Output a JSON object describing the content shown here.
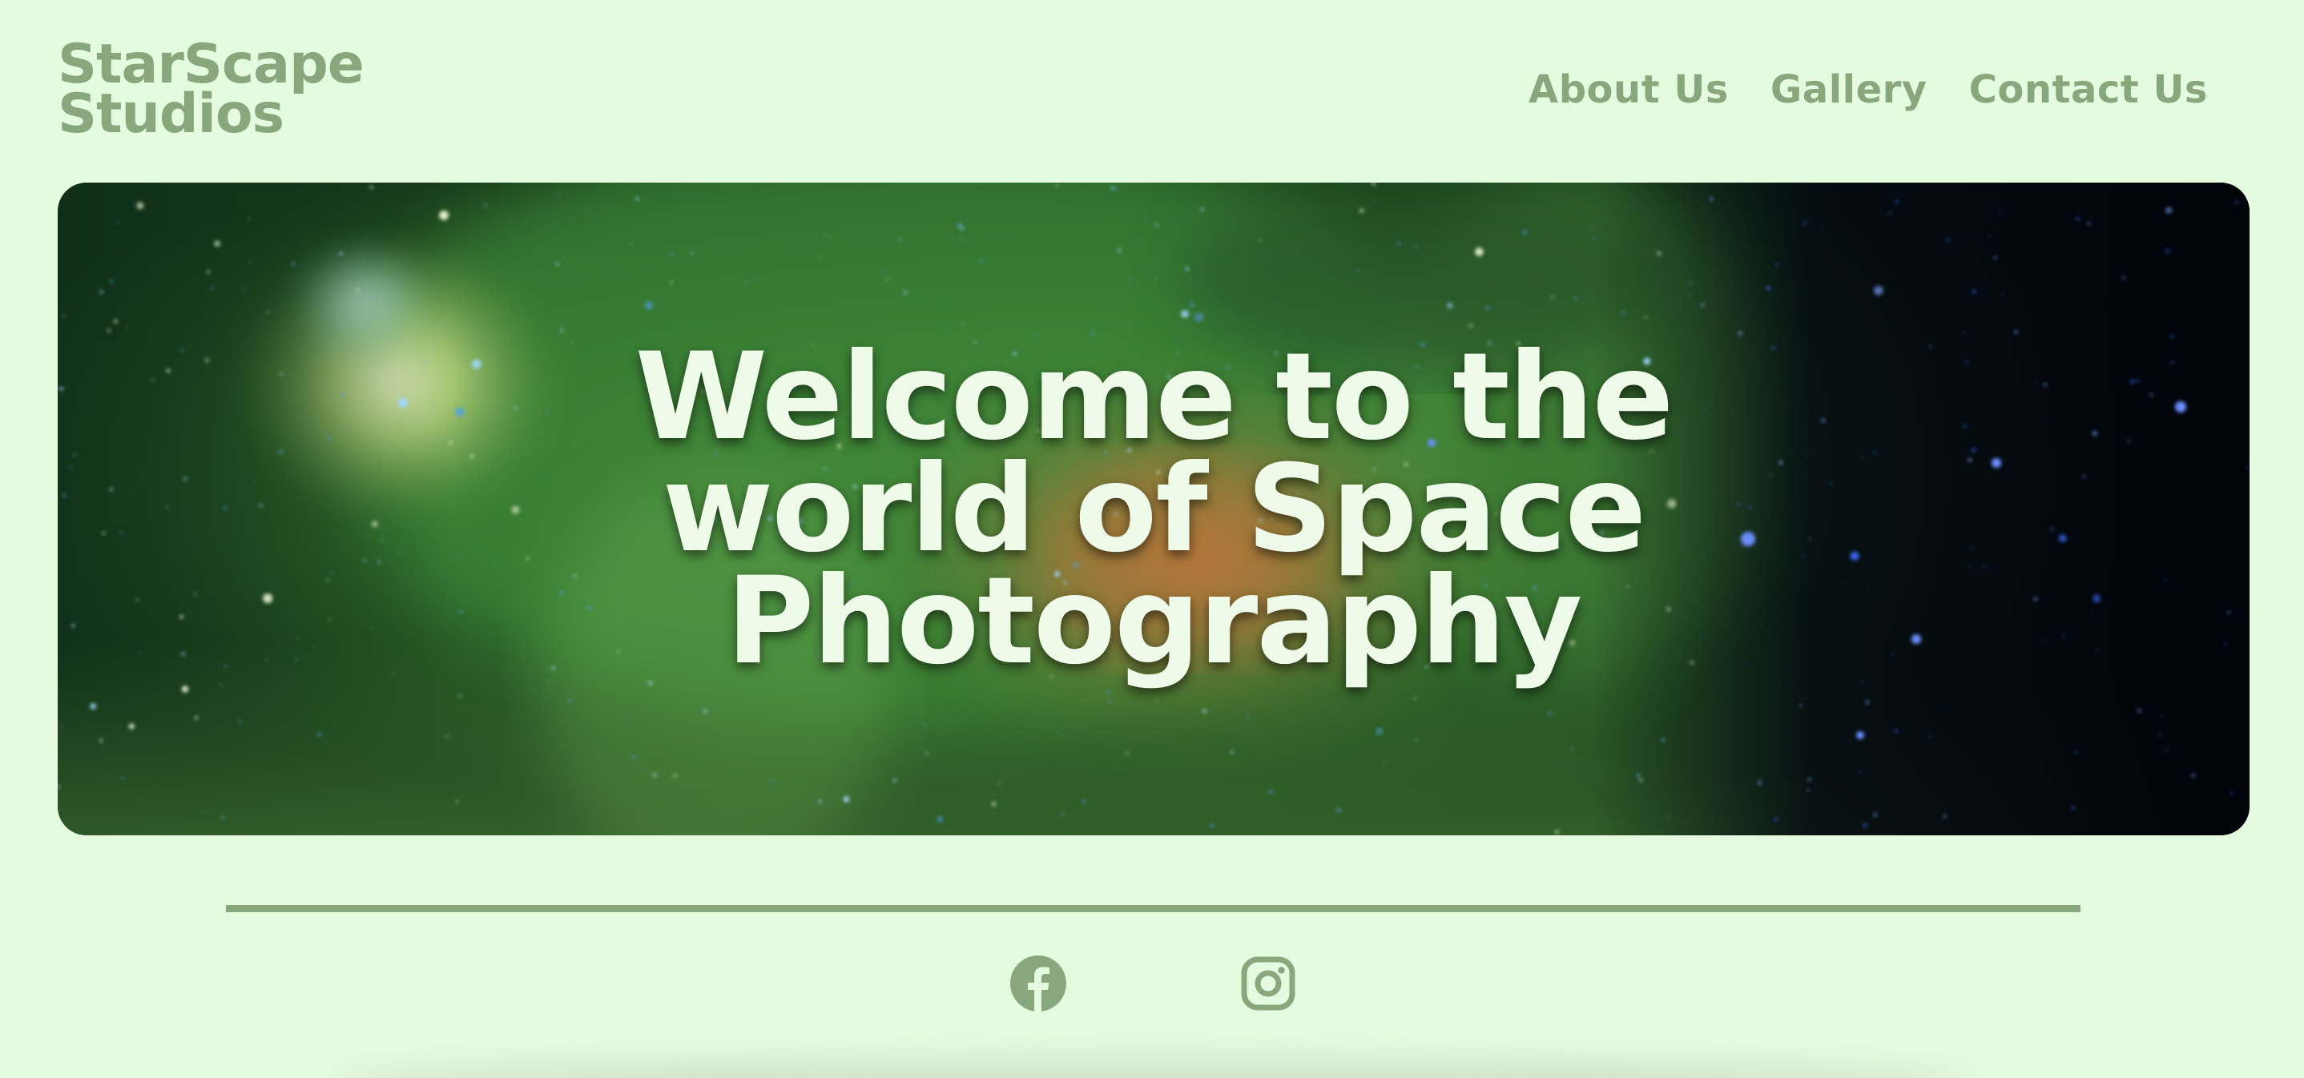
{
  "brand": {
    "line1": "StarScape",
    "line2": "Studios"
  },
  "nav": {
    "items": [
      {
        "label": "About Us"
      },
      {
        "label": "Gallery"
      },
      {
        "label": "Contact Us"
      }
    ]
  },
  "hero": {
    "title": "Welcome to the world of Space Photography"
  },
  "socials": {
    "icons": [
      "facebook-icon",
      "instagram-icon"
    ]
  },
  "colors": {
    "background": "#e5fbdf",
    "accent": "#88a77c",
    "hero_text": "#eefbe9"
  }
}
